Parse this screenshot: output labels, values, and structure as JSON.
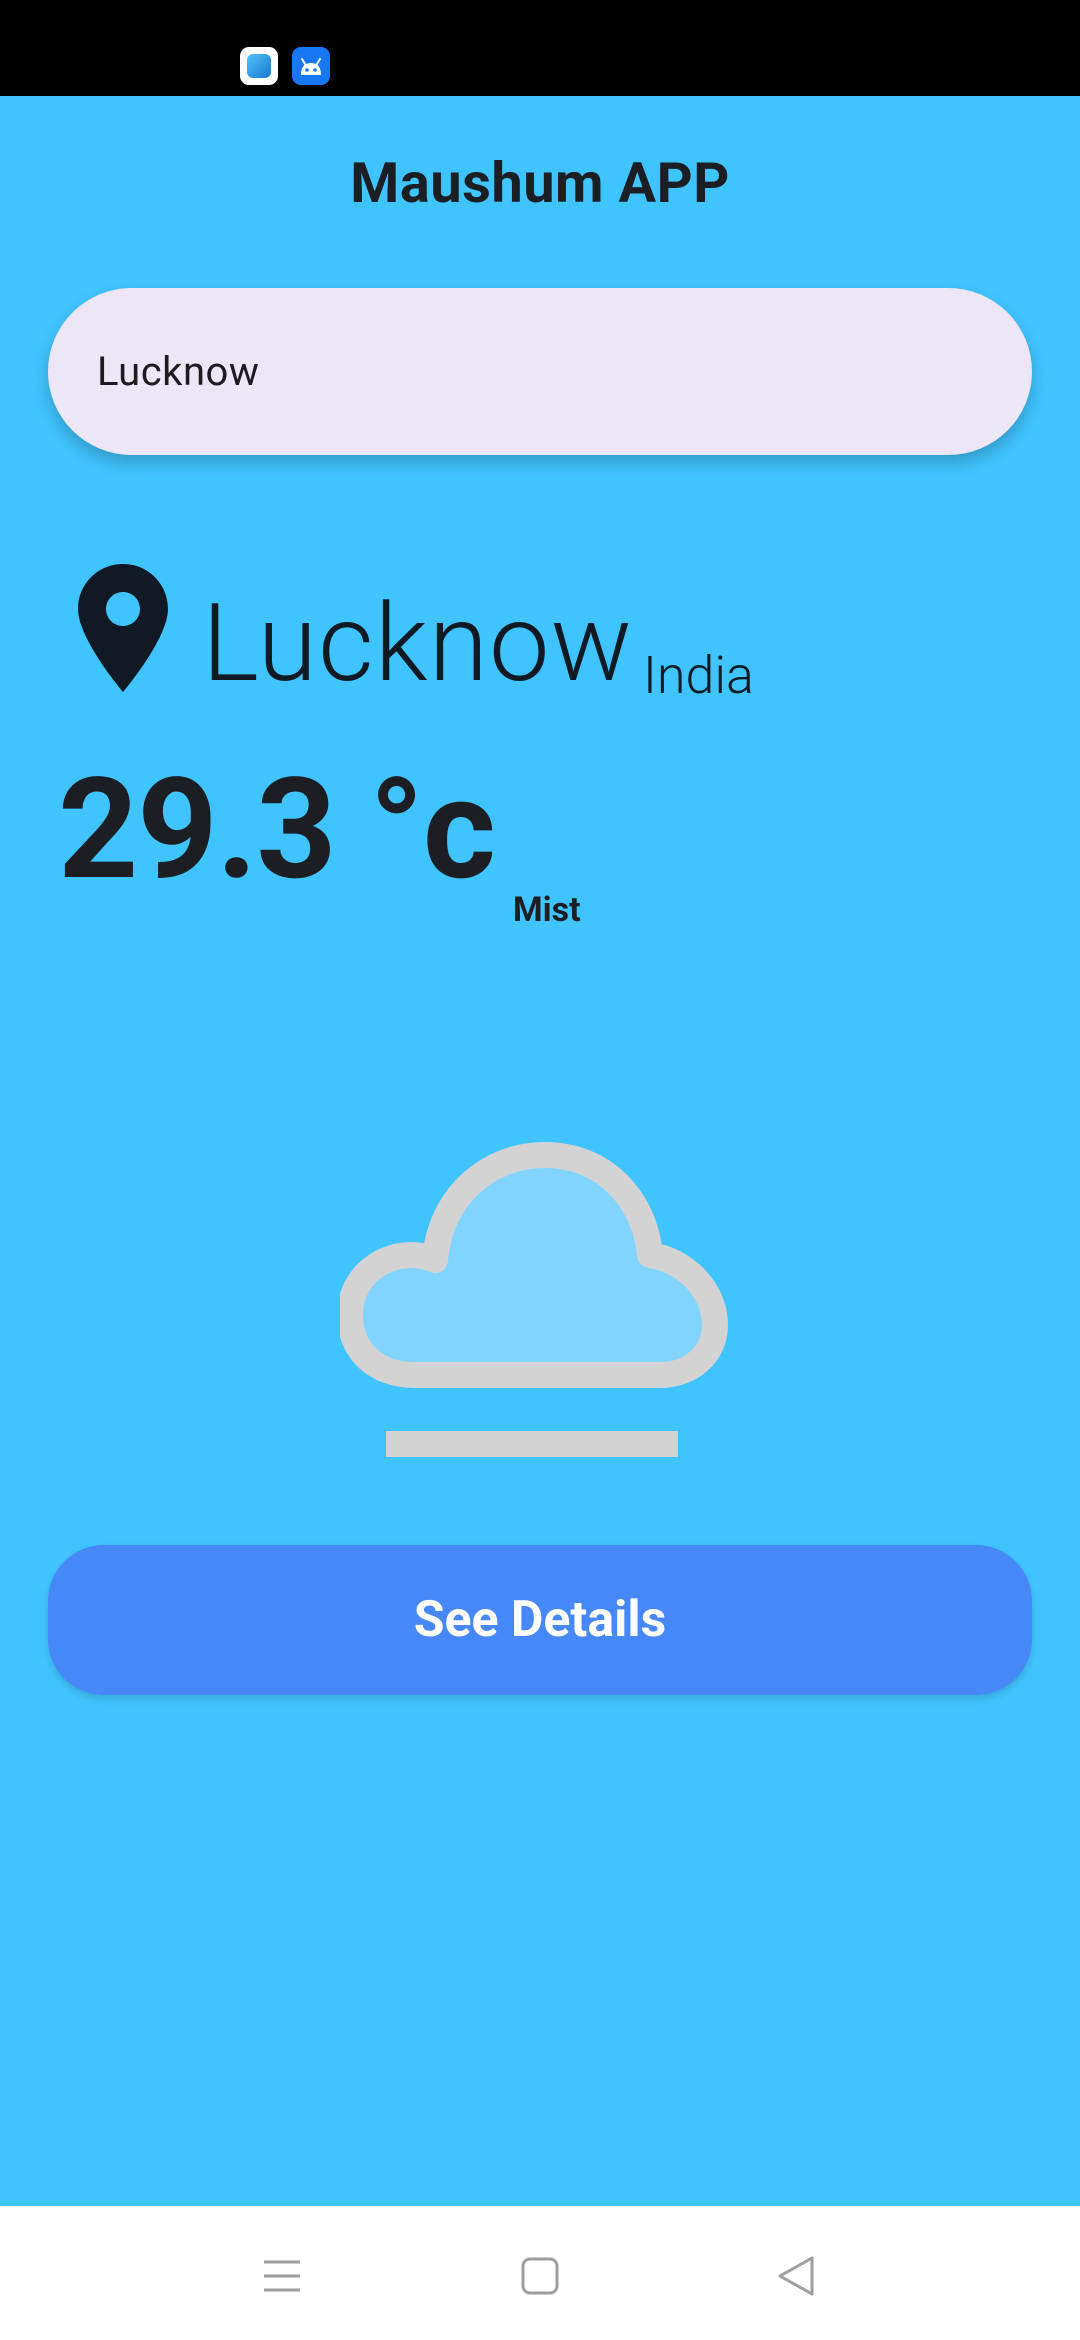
{
  "status_bar": {
    "icons": [
      "app-notification-icon",
      "android-icon"
    ]
  },
  "app": {
    "title": "Maushum APP",
    "background_color": "#40C4FF"
  },
  "search": {
    "value": "Lucknow",
    "placeholder": ""
  },
  "location": {
    "icon": "location-pin-icon",
    "city": "Lucknow",
    "country": "India"
  },
  "weather": {
    "temperature": "29.3 °c",
    "condition": "Mist",
    "icon": "mist-cloud-icon"
  },
  "actions": {
    "details_label": "See Details",
    "button_color": "#4788F8"
  },
  "nav_bar": {
    "icons": [
      "menu-icon",
      "home-icon",
      "back-icon"
    ]
  }
}
